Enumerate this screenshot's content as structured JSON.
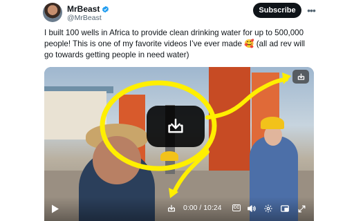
{
  "author": {
    "name": "MrBeast",
    "handle": "@MrBeast",
    "verified_color": "#1d9bf0"
  },
  "header": {
    "subscribe_label": "Subscribe",
    "more_icon": "more-horizontal-icon"
  },
  "tweet": {
    "text": "I built 100 wells in Africa to provide clean drinking water for up to 500,000 people! This is one of my favorite videos I’ve ever made 🥰 (all ad rev will go towards getting people in need water)"
  },
  "video": {
    "download_icon": "download-icon",
    "annotation_color": "#ffef00",
    "controls": {
      "time": "0:00 / 10:24",
      "cc_label": "CC",
      "progress": 0
    }
  }
}
